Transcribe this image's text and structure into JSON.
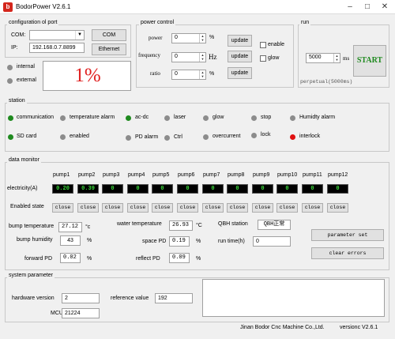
{
  "window": {
    "title": "BodorPower V2.6.1",
    "app_icon": "b"
  },
  "config_port": {
    "title": "configuration ol port",
    "com_label": "COM:",
    "com_value": "",
    "com_button": "COM",
    "ip_label": "IP:",
    "ip_value": "192.168.0.7.8899",
    "ethernet_button": "Ethernet"
  },
  "connection": {
    "internal_label": "internal",
    "external_label": "external",
    "display_value": "1%"
  },
  "power_control": {
    "title": "power control",
    "rows": [
      {
        "label": "power",
        "value": "0",
        "unit": "%",
        "button": "update",
        "check_label": "enable"
      },
      {
        "label": "frequency",
        "value": "0",
        "unit": "Hz",
        "button": "update",
        "check_label": "glow"
      },
      {
        "label": "ratio",
        "value": "0",
        "unit": "%",
        "button": "update"
      }
    ]
  },
  "run": {
    "title": "run",
    "value": "5000",
    "unit": "ms",
    "start_button": "START",
    "perpetual_label": "perpetual(5000ms)"
  },
  "station": {
    "title": "station",
    "items": [
      {
        "label": "communication",
        "color": "#1f8a1f"
      },
      {
        "label": "temperature alarm",
        "color": "#8c8c8c"
      },
      {
        "label": "ac-dc",
        "color": "#1f8a1f"
      },
      {
        "label": "laser",
        "color": "#8c8c8c"
      },
      {
        "label": "glow",
        "color": "#8c8c8c"
      },
      {
        "label": "stop",
        "color": "#8c8c8c"
      },
      {
        "label": "Humidty alarm",
        "color": "#8c8c8c"
      },
      {
        "label": "SD card",
        "color": "#1f8a1f"
      },
      {
        "label": "enabled",
        "color": "#8c8c8c"
      },
      {
        "label": "PD alarm",
        "color": "#8c8c8c"
      },
      {
        "label": "Ctrl",
        "color": "#8c8c8c"
      },
      {
        "label": "overcurrent",
        "color": "#8c8c8c"
      },
      {
        "label": "lock",
        "color": "#8c8c8c"
      },
      {
        "label": "interlock",
        "color": "#e01010"
      }
    ]
  },
  "data_monitor": {
    "title": "data monitor",
    "pump_labels": [
      "pump1",
      "pump2",
      "pump3",
      "pump4",
      "pump5",
      "pump6",
      "pump7",
      "pump8",
      "pump9",
      "pump10",
      "pump11",
      "pump12"
    ],
    "electricity_label": "electricity(A)",
    "electricity_values": [
      "0.20",
      "0.39",
      "0",
      "0",
      "0",
      "0",
      "0",
      "0",
      "0",
      "0",
      "0",
      "0"
    ],
    "enabled_state_label": "Enabled state",
    "close_label": "close",
    "bump_temperature_label": "bump temperature",
    "bump_temperature_value": "27.12",
    "bump_temperature_unit": "°c",
    "water_temperature_label": "water temperature",
    "water_temperature_value": "26.93",
    "water_temperature_unit": "°C",
    "qbh_label": "QBH station",
    "qbh_value": "QBH正常",
    "bump_humidity_label": "bump humidity",
    "bump_humidity_value": "43",
    "bump_humidity_unit": "%",
    "space_pd_label": "space PD",
    "space_pd_value": "0.19",
    "space_pd_unit": "%",
    "run_time_label": "run time(h)",
    "run_time_value": "0",
    "forward_pd_label": "forward PD",
    "forward_pd_value": "0.02",
    "forward_pd_unit": "%",
    "reflect_pd_label": "reflect PD",
    "reflect_pd_value": "0.09",
    "reflect_pd_unit": "%",
    "parameter_set_button": "parameter set",
    "clear_errors_button": "clear errors"
  },
  "system_parameter": {
    "title": "system parameter",
    "hardware_version_label": "hardware version",
    "hardware_version_value": "2",
    "reference_value_label": "reference value",
    "reference_value_value": "192",
    "mcu_label": "MCU",
    "mcu_value": "21224",
    "log_text": ""
  },
  "footer": {
    "company": "Jinan Bodor Cnc Machine Co.,Ltd.",
    "version": "versionc V2.6.1"
  }
}
